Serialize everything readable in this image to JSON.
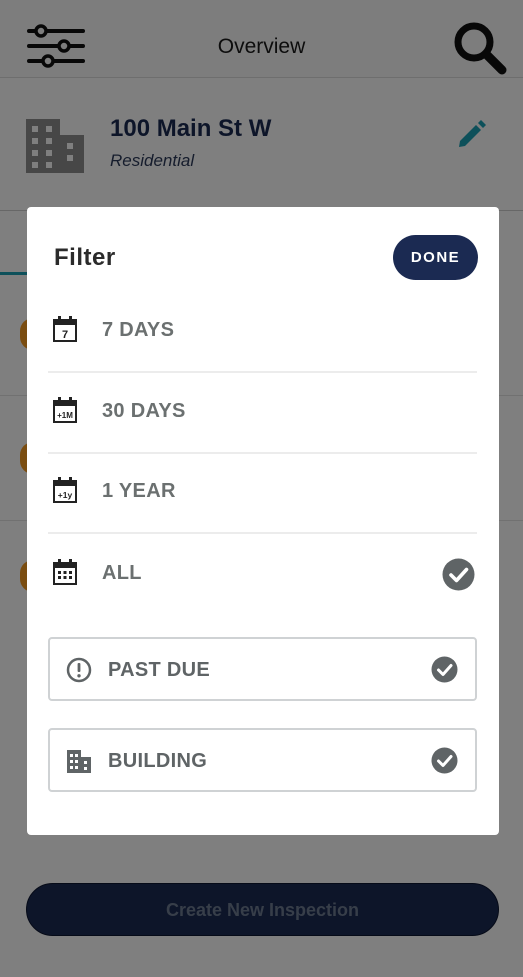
{
  "header": {
    "title": "Overview"
  },
  "property": {
    "address": "100 Main St W",
    "type": "Residential"
  },
  "actions": {
    "create_label": "Create New Inspection"
  },
  "filter": {
    "title": "Filter",
    "done_label": "DONE",
    "periods": [
      {
        "label": "7 DAYS",
        "icon": "calendar-7-icon",
        "icon_text": "7",
        "selected": false
      },
      {
        "label": "30 DAYS",
        "icon": "calendar-1m-icon",
        "icon_text": "+1M",
        "selected": false
      },
      {
        "label": "1 YEAR",
        "icon": "calendar-1y-icon",
        "icon_text": "+1y",
        "selected": false
      },
      {
        "label": "ALL",
        "icon": "calendar-all-icon",
        "icon_text": "",
        "selected": true
      }
    ],
    "toggles": [
      {
        "label": "PAST DUE",
        "icon": "alert-circle-icon",
        "checked": true
      },
      {
        "label": "BUILDING",
        "icon": "building-icon",
        "checked": true
      }
    ]
  },
  "colors": {
    "navy": "#1b2a52",
    "accent_teal": "#1aa0b4",
    "status_orange": "#f59b23",
    "check_gray": "#5f6466"
  }
}
